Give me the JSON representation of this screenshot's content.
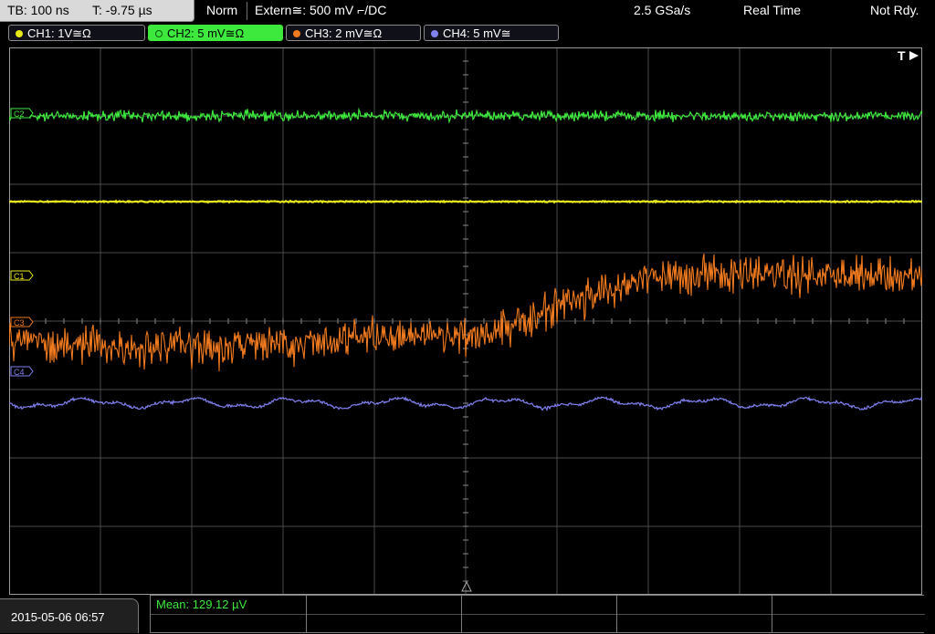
{
  "header": {
    "timebase": "TB: 100 ns",
    "trigger_time": "T: -9.75 µs",
    "mode": "Norm",
    "trigger_source": "Extern≅: 500 mV ⌐/DC",
    "sample_rate": "2.5 GSa/s",
    "acq_mode": "Real Time",
    "status": "Not Rdy."
  },
  "channels": [
    {
      "id": "ch1",
      "label": "CH1: 1V≅Ω",
      "color": "#e8e81a",
      "active": false
    },
    {
      "id": "ch2",
      "label": "CH2: 5 mV≅Ω",
      "color": "#3de93d",
      "active": true
    },
    {
      "id": "ch3",
      "label": "CH3: 2 mV≅Ω",
      "color": "#f07a1e",
      "active": false
    },
    {
      "id": "ch4",
      "label": "CH4: 5 mV≅",
      "color": "#8080f0",
      "active": false
    }
  ],
  "markers": {
    "trigger": "T",
    "c1": "C1",
    "c2": "C2",
    "c3": "C3",
    "c4": "C4"
  },
  "footer": {
    "datetime": "2015-05-06 06:57",
    "measurement": "Mean: 129.12 µV"
  },
  "colors": {
    "grid": "#4a4a4a",
    "graticule_axis": "#8a8a8a",
    "frame": "#9a9a9a"
  }
}
